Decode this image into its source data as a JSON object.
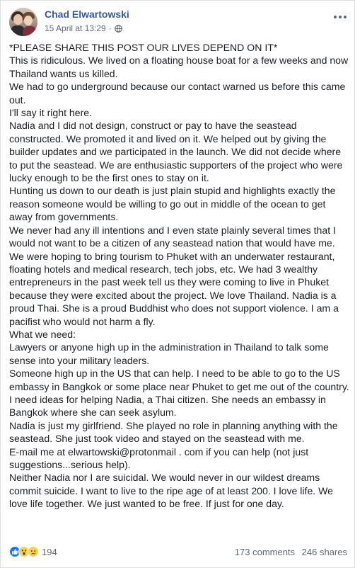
{
  "post": {
    "author": "Chad Elwartowski",
    "timestamp": "15 April at 13:29",
    "separator": "·",
    "privacy_icon": "globe-icon",
    "more_icon": "more-options-icon",
    "paragraphs": [
      "*PLEASE SHARE THIS POST OUR LIVES DEPEND ON IT*",
      "This is ridiculous. We lived on a floating house boat for a few weeks and now Thailand wants us killed.",
      "We had to go underground because our contact warned us before this came out.",
      "I'll say it right here.",
      "Nadia and I did not design, construct or pay to have the seastead constructed. We promoted it and lived on it. We helped out by giving the builder updates and we participated in the launch. We did not decide where to put the seastead. We are enthusiastic supporters of the project who were lucky enough to be the first ones to stay on it.",
      "Hunting us down to our death is just plain stupid and highlights exactly the reason someone would be willing to go out in middle of the ocean to get away from governments.",
      "We never had any ill intentions and I even state plainly several times that I would not want to be a citizen of any seastead nation that would have me.",
      "We were hoping to bring tourism to Phuket with an underwater restaurant, floating hotels and medical research, tech jobs, etc. We had 3 wealthy entrepreneurs in the past week tell us they were coming to live in Phuket because they were excited about the project. We love Thailand. Nadia is a proud Thai. She is a proud Buddhist who does not support violence. I am a pacifist who would not harm a fly.",
      "What we need:",
      "Lawyers or anyone high up in the administration in Thailand to talk some sense into your military leaders.",
      "Someone high up in the US that can help. I need to be able to go to the US embassy in Bangkok or some place near Phuket to get me out of the country.",
      "I need ideas for helping Nadia, a Thai citizen. She needs an embassy in Bangkok where she can seek asylum.",
      "Nadia is just my girlfriend. She played no role in planning anything with the seastead. She just took video and stayed on the seastead with me.",
      "E-mail me at elwartowski@protonmail . com if you can help (not just suggestions...serious help).",
      "Neither Nadia nor I are suicidal. We would never in our wildest dreams commit suicide. I want to live to the ripe age of at least 200. I love life. We love life together. We just wanted to be free. If just for one day."
    ]
  },
  "footer": {
    "reaction_icons": [
      "like-icon",
      "wow-icon",
      "sad-icon"
    ],
    "reaction_count": "194",
    "comments": "173 comments",
    "shares": "246 shares"
  },
  "colors": {
    "author_link": "#385898",
    "meta_text": "#606770",
    "like_blue": "#1877f2",
    "emoji_yellow": "#f7d14f"
  }
}
